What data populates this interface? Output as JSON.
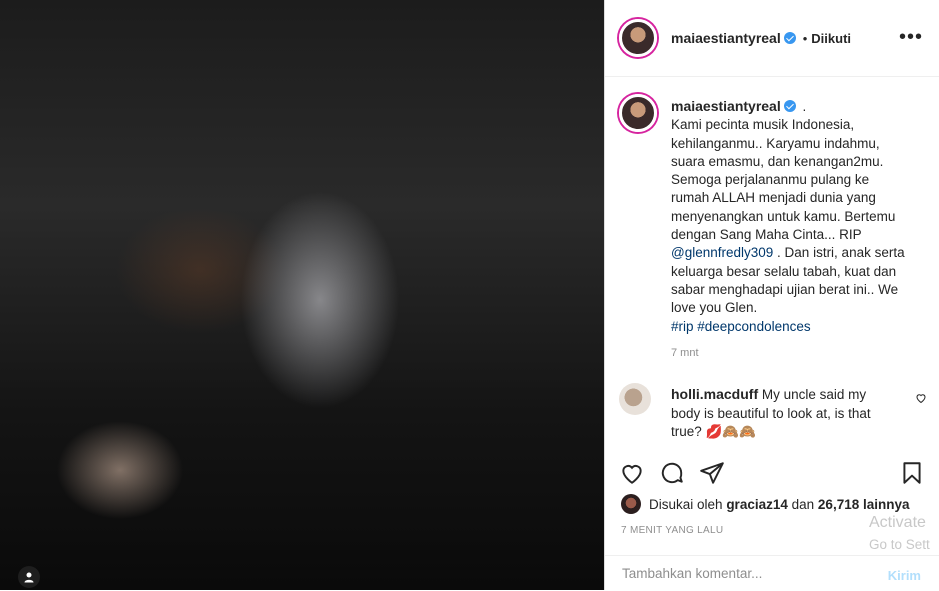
{
  "post": {
    "username": "maiaestiantyreal",
    "follow_status": "Diikuti",
    "more_label": "•••",
    "caption_separator": ".",
    "caption_lines": [
      "Kami pecinta musik Indonesia,",
      "kehilanganmu.. Karyamu indahmu,",
      "suara emasmu, dan kenangan2mu.",
      "Semoga perjalananmu pulang ke",
      "rumah ALLAH menjadi dunia yang",
      "menyenangkan untuk kamu. Bertemu",
      "dengan Sang Maha Cinta... RIP"
    ],
    "mention": "@glennfredly309",
    "caption_after_mention": ". Dan istri, anak serta keluarga besar selalu tabah, kuat dan sabar menghadapi ujian berat ini.. We love you Glen.",
    "hashtags": "#rip #deepcondolences",
    "time_ago": "7 mnt"
  },
  "comment": {
    "username": "holli.macduff",
    "text": "My uncle said my body is beautiful to look at, is that true?",
    "emojis": "💋🙈🙈"
  },
  "likes": {
    "prefix": "Disukai oleh",
    "first_liker": "graciaz14",
    "middle": "dan",
    "count": "26,718 lainnya"
  },
  "date_label": "7 MENIT YANG LALU",
  "add_comment": {
    "placeholder": "Tambahkan komentar...",
    "post_label": "Kirim"
  },
  "watermark": {
    "line1": "Activate",
    "line2": "Go to Sett"
  },
  "colors": {
    "verified": "#3897f0",
    "link": "#00376b",
    "muted": "#8e8e8e",
    "post_button": "#b2dffc"
  },
  "icons": [
    "person-icon",
    "verified-icon",
    "more-icon",
    "heart-icon",
    "comment-icon",
    "share-icon",
    "bookmark-icon"
  ]
}
